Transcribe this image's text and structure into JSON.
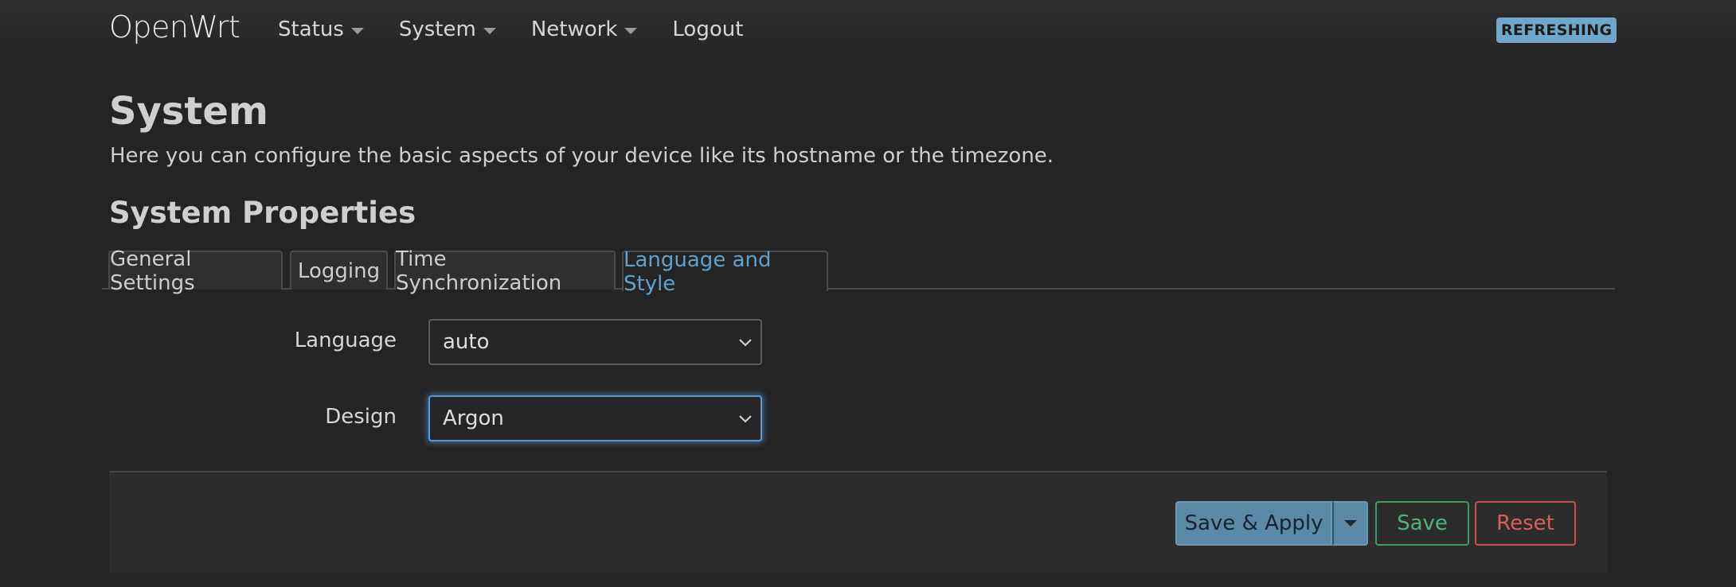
{
  "navbar": {
    "brand": "OpenWrt",
    "items": [
      {
        "label": "Status",
        "dropdown": true
      },
      {
        "label": "System",
        "dropdown": true
      },
      {
        "label": "Network",
        "dropdown": true
      },
      {
        "label": "Logout",
        "dropdown": false
      }
    ],
    "badge": "REFRESHING"
  },
  "page": {
    "title": "System",
    "description": "Here you can configure the basic aspects of your device like its hostname or the timezone.",
    "section_title": "System Properties"
  },
  "tabs": [
    {
      "label": "General Settings",
      "active": false
    },
    {
      "label": "Logging",
      "active": false
    },
    {
      "label": "Time Synchronization",
      "active": false
    },
    {
      "label": "Language and Style",
      "active": true
    }
  ],
  "form": {
    "language": {
      "label": "Language",
      "value": "auto"
    },
    "design": {
      "label": "Design",
      "value": "Argon"
    }
  },
  "actions": {
    "save_apply": "Save & Apply",
    "save": "Save",
    "reset": "Reset"
  },
  "colors": {
    "background": "#242424",
    "accent": "#5ea3d0",
    "badge": "#6fa6c9",
    "save_green": "#4fb47a",
    "reset_red": "#d8605b",
    "apply_blue": "#5b8aa6"
  }
}
